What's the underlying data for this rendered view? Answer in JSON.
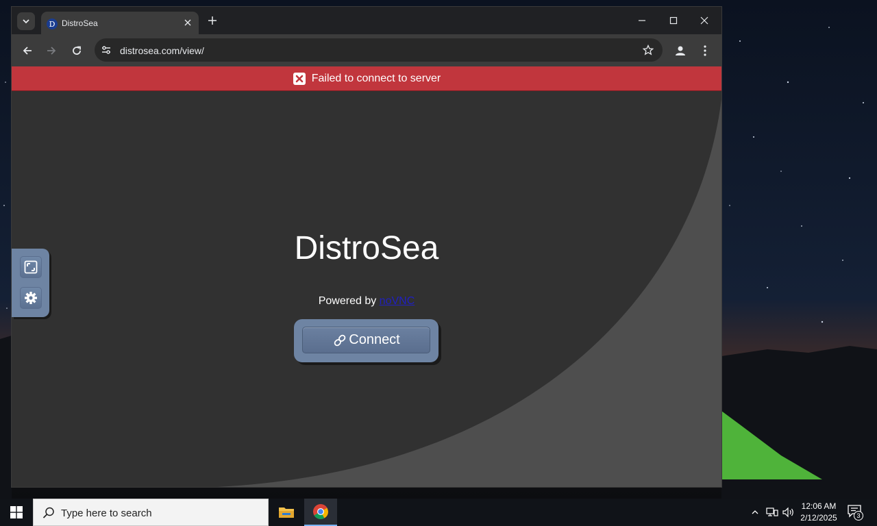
{
  "browser": {
    "tab": {
      "favicon_letter": "D",
      "title": "DistroSea"
    },
    "address_bar": {
      "url": "distrosea.com/view/"
    }
  },
  "page": {
    "error_banner": {
      "text": "Failed to connect to server",
      "color": "#c1363d"
    },
    "title": "DistroSea",
    "powered_by": {
      "prefix": "Powered by ",
      "link_text": "noVNC"
    },
    "connect_button": {
      "label": "Connect"
    },
    "control_bar": {
      "icons": [
        "fullscreen-icon",
        "settings-gear-icon"
      ]
    },
    "accent_color": "#6e84a3"
  },
  "taskbar": {
    "search_placeholder": "Type here to search",
    "apps": [
      "file-explorer",
      "google-chrome"
    ],
    "clock": {
      "time": "12:06 AM",
      "date": "2/12/2025"
    },
    "notification_count": "3"
  }
}
